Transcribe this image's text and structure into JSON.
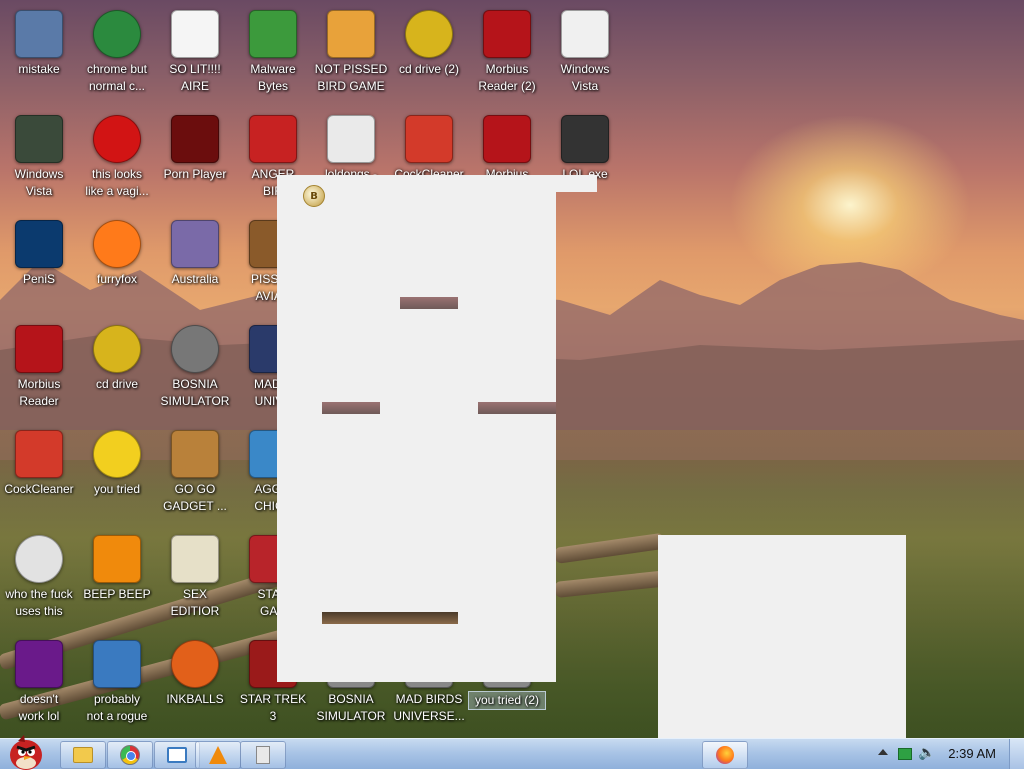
{
  "desktop": {
    "icons": [
      {
        "label": "mistake",
        "icon": "network-setup-icon",
        "color": "#5a7aa8"
      },
      {
        "label": "chrome but\nnormal c...",
        "icon": "chrome-icon",
        "color": "#2b8a3e"
      },
      {
        "label": "SO LIT!!!!\nAIRE",
        "icon": "solitaire-icon",
        "color": "#f5f5f5"
      },
      {
        "label": "Malware\nBytes",
        "icon": "shield-check-icon",
        "color": "#3c9a3c"
      },
      {
        "label": "NOT PISSED\nBIRD GAME",
        "icon": "green-pig-icon",
        "color": "#e8a23a"
      },
      {
        "label": "cd drive (2)",
        "icon": "cd-icon",
        "color": "#d7b41c"
      },
      {
        "label": "Morbius\nReader (2)",
        "icon": "pdf-icon",
        "color": "#b5141a"
      },
      {
        "label": "Windows\nVista",
        "icon": "blank-document-icon",
        "color": "#f0f0f0"
      },
      {
        "label": "Windows\nVista",
        "icon": "recycle-bin-icon",
        "color": "#3a4a3a"
      },
      {
        "label": "this looks\nlike a vagi...",
        "icon": "opera-icon",
        "color": "#d21414"
      },
      {
        "label": "Porn Player",
        "icon": "flash-icon",
        "color": "#6b0d0d"
      },
      {
        "label": "ANGER\nBIR",
        "icon": "angry-bird-icon",
        "color": "#c72222"
      },
      {
        "label": "loldongs -",
        "icon": "text-document-icon",
        "color": "#eaeaea"
      },
      {
        "label": "CockCleaner",
        "icon": "ccleaner-icon",
        "color": "#d33a2a"
      },
      {
        "label": "Morbius",
        "icon": "pdf-icon",
        "color": "#b5141a"
      },
      {
        "label": "LOL.exe",
        "icon": "executable-icon",
        "color": "#333333"
      },
      {
        "label": "PeniS",
        "icon": "photoshop-icon",
        "color": "#0b3a6e"
      },
      {
        "label": "furryfox",
        "icon": "firefox-icon",
        "color": "#ff7a1a"
      },
      {
        "label": "Australia",
        "icon": "spider-solitaire-icon",
        "color": "#7a6aa8"
      },
      {
        "label": "PISSED\nAVIAN",
        "icon": "angry-birds-seasons-icon",
        "color": "#8a5a2a"
      },
      {
        "label": "Morbius\nReader",
        "icon": "pdf-icon",
        "color": "#b5141a"
      },
      {
        "label": "cd drive",
        "icon": "cd-icon",
        "color": "#d7b41c"
      },
      {
        "label": "BOSNIA\nSIMULATOR",
        "icon": "minesweeper-icon",
        "color": "#777777"
      },
      {
        "label": "MAD B\nUNIVE",
        "icon": "angry-birds-space-icon",
        "color": "#2a3a6a"
      },
      {
        "label": "CockCleaner",
        "icon": "ccleaner-icon",
        "color": "#d33a2a"
      },
      {
        "label": "you tried",
        "icon": "star-icon",
        "color": "#f2cf1f"
      },
      {
        "label": "GO GO\nGADGET ...",
        "icon": "briefcase-icon",
        "color": "#b9813a"
      },
      {
        "label": "AGGIT\nCHICK",
        "icon": "angry-birds-rio-icon",
        "color": "#3a88c8"
      },
      {
        "label": "who the fuck\nuses this",
        "icon": "lightning-icon",
        "color": "#e2e2e2"
      },
      {
        "label": "BEEP BEEP",
        "icon": "vlc-cone-icon",
        "color": "#f08a0c"
      },
      {
        "label": "SEX\nEDITIOR",
        "icon": "hxd-icon",
        "color": "#e6e0c8"
      },
      {
        "label": "STAR\nGAN",
        "icon": "angry-birds-star-wars-icon",
        "color": "#b8242a"
      },
      {
        "label": "doesn't\nwork lol",
        "icon": "yahoo-messenger-icon",
        "color": "#6a1a8a"
      },
      {
        "label": "probably\nnot a rogue",
        "icon": "control-panel-icon",
        "color": "#3a7ac0"
      },
      {
        "label": "INKBALLS",
        "icon": "inkball-icon",
        "color": "#e2601a"
      },
      {
        "label": "STAR TREK\n3",
        "icon": "star-trek-icon",
        "color": "#9a1a1a"
      },
      {
        "label": "BOSNIA\nSIMULATOR",
        "icon": "generic-icon",
        "color": "#888888"
      },
      {
        "label": "MAD BIRDS\nUNIVERSE...",
        "icon": "generic-icon",
        "color": "#888888"
      },
      {
        "label": "you tried (2)",
        "icon": "generic-icon",
        "color": "#888888"
      }
    ]
  },
  "overlay": {
    "ghost_badge": "B"
  },
  "taskbar": {
    "start": {
      "icon": "angry-bird-start-icon",
      "color": "#c72222"
    },
    "pinned": [
      {
        "icon": "folder-icon",
        "color": "#f2c94c"
      },
      {
        "icon": "chrome-icon",
        "color": "#2b8a3e"
      },
      {
        "icon": "window-switcher-icon",
        "color": "#3a7ac0"
      },
      {
        "icon": "vlc-cone-icon",
        "color": "#f08a0c"
      },
      {
        "icon": "calculator-icon",
        "color": "#d8d8d8"
      }
    ],
    "running": [
      {
        "icon": "firefox-icon",
        "color": "#ff7a1a"
      }
    ],
    "clock": "2:39 AM"
  }
}
